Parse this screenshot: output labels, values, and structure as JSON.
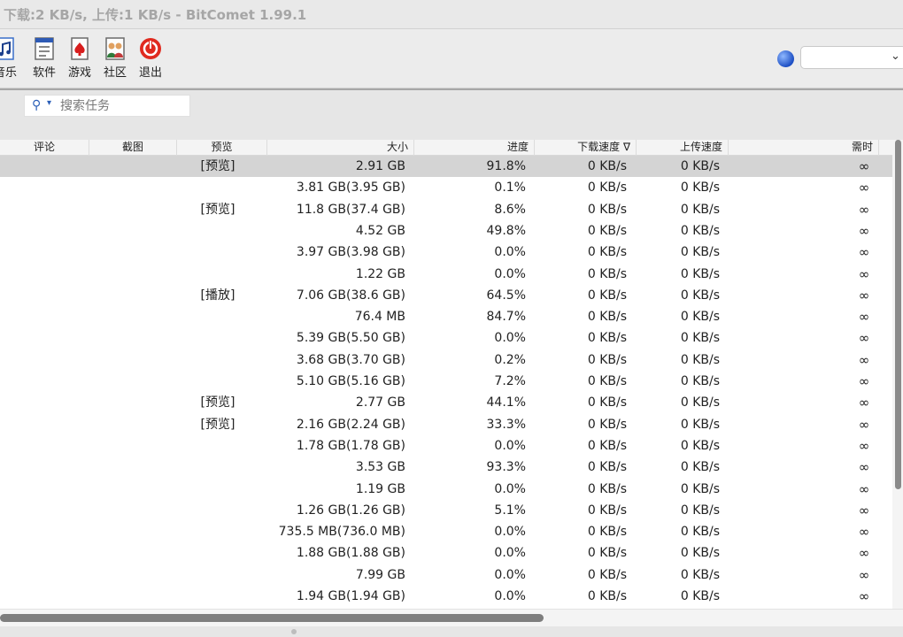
{
  "window": {
    "title": "下载:2 KB/s, 上传:1 KB/s - BitComet 1.99.1"
  },
  "toolbar": {
    "buttons": [
      {
        "label": "音乐",
        "icon": "music-icon"
      },
      {
        "label": "软件",
        "icon": "software-icon"
      },
      {
        "label": "游戏",
        "icon": "game-icon"
      },
      {
        "label": "社区",
        "icon": "community-icon"
      },
      {
        "label": "退出",
        "icon": "exit-icon"
      }
    ],
    "select_value": ""
  },
  "search": {
    "placeholder": "搜索任务"
  },
  "table": {
    "columns": [
      "评论",
      "截图",
      "预览",
      "大小",
      "进度",
      "下载速度 ∇",
      "上传速度",
      "需时"
    ],
    "rows": [
      {
        "preview": "[预览]",
        "size": "2.91 GB",
        "progress": "91.8%",
        "dl": "0 KB/s",
        "ul": "0 KB/s",
        "eta": "∞",
        "selected": true
      },
      {
        "preview": "",
        "size": "3.81 GB(3.95 GB)",
        "progress": "0.1%",
        "dl": "0 KB/s",
        "ul": "0 KB/s",
        "eta": "∞"
      },
      {
        "preview": "[预览]",
        "size": "11.8 GB(37.4 GB)",
        "progress": "8.6%",
        "dl": "0 KB/s",
        "ul": "0 KB/s",
        "eta": "∞"
      },
      {
        "preview": "",
        "size": "4.52 GB",
        "progress": "49.8%",
        "dl": "0 KB/s",
        "ul": "0 KB/s",
        "eta": "∞"
      },
      {
        "preview": "",
        "size": "3.97 GB(3.98 GB)",
        "progress": "0.0%",
        "dl": "0 KB/s",
        "ul": "0 KB/s",
        "eta": "∞"
      },
      {
        "preview": "",
        "size": "1.22 GB",
        "progress": "0.0%",
        "dl": "0 KB/s",
        "ul": "0 KB/s",
        "eta": "∞"
      },
      {
        "preview": "[播放]",
        "size": "7.06 GB(38.6 GB)",
        "progress": "64.5%",
        "dl": "0 KB/s",
        "ul": "0 KB/s",
        "eta": "∞"
      },
      {
        "preview": "",
        "size": "76.4 MB",
        "progress": "84.7%",
        "dl": "0 KB/s",
        "ul": "0 KB/s",
        "eta": "∞"
      },
      {
        "preview": "",
        "size": "5.39 GB(5.50 GB)",
        "progress": "0.0%",
        "dl": "0 KB/s",
        "ul": "0 KB/s",
        "eta": "∞"
      },
      {
        "preview": "",
        "size": "3.68 GB(3.70 GB)",
        "progress": "0.2%",
        "dl": "0 KB/s",
        "ul": "0 KB/s",
        "eta": "∞"
      },
      {
        "preview": "",
        "size": "5.10 GB(5.16 GB)",
        "progress": "7.2%",
        "dl": "0 KB/s",
        "ul": "0 KB/s",
        "eta": "∞"
      },
      {
        "preview": "[预览]",
        "size": "2.77 GB",
        "progress": "44.1%",
        "dl": "0 KB/s",
        "ul": "0 KB/s",
        "eta": "∞"
      },
      {
        "preview": "[预览]",
        "size": "2.16 GB(2.24 GB)",
        "progress": "33.3%",
        "dl": "0 KB/s",
        "ul": "0 KB/s",
        "eta": "∞"
      },
      {
        "preview": "",
        "size": "1.78 GB(1.78 GB)",
        "progress": "0.0%",
        "dl": "0 KB/s",
        "ul": "0 KB/s",
        "eta": "∞"
      },
      {
        "preview": "",
        "size": "3.53 GB",
        "progress": "93.3%",
        "dl": "0 KB/s",
        "ul": "0 KB/s",
        "eta": "∞"
      },
      {
        "preview": "",
        "size": "1.19 GB",
        "progress": "0.0%",
        "dl": "0 KB/s",
        "ul": "0 KB/s",
        "eta": "∞"
      },
      {
        "preview": "",
        "size": "1.26 GB(1.26 GB)",
        "progress": "5.1%",
        "dl": "0 KB/s",
        "ul": "0 KB/s",
        "eta": "∞"
      },
      {
        "preview": "",
        "size": "735.5 MB(736.0 MB)",
        "progress": "0.0%",
        "dl": "0 KB/s",
        "ul": "0 KB/s",
        "eta": "∞"
      },
      {
        "preview": "",
        "size": "1.88 GB(1.88 GB)",
        "progress": "0.0%",
        "dl": "0 KB/s",
        "ul": "0 KB/s",
        "eta": "∞"
      },
      {
        "preview": "",
        "size": "7.99 GB",
        "progress": "0.0%",
        "dl": "0 KB/s",
        "ul": "0 KB/s",
        "eta": "∞"
      },
      {
        "preview": "",
        "size": "1.94 GB(1.94 GB)",
        "progress": "0.0%",
        "dl": "0 KB/s",
        "ul": "0 KB/s",
        "eta": "∞"
      }
    ]
  },
  "colors": {
    "selected_row": "#d4d4d4",
    "accent": "#2b5fb8",
    "exit_red": "#e02a1f"
  }
}
